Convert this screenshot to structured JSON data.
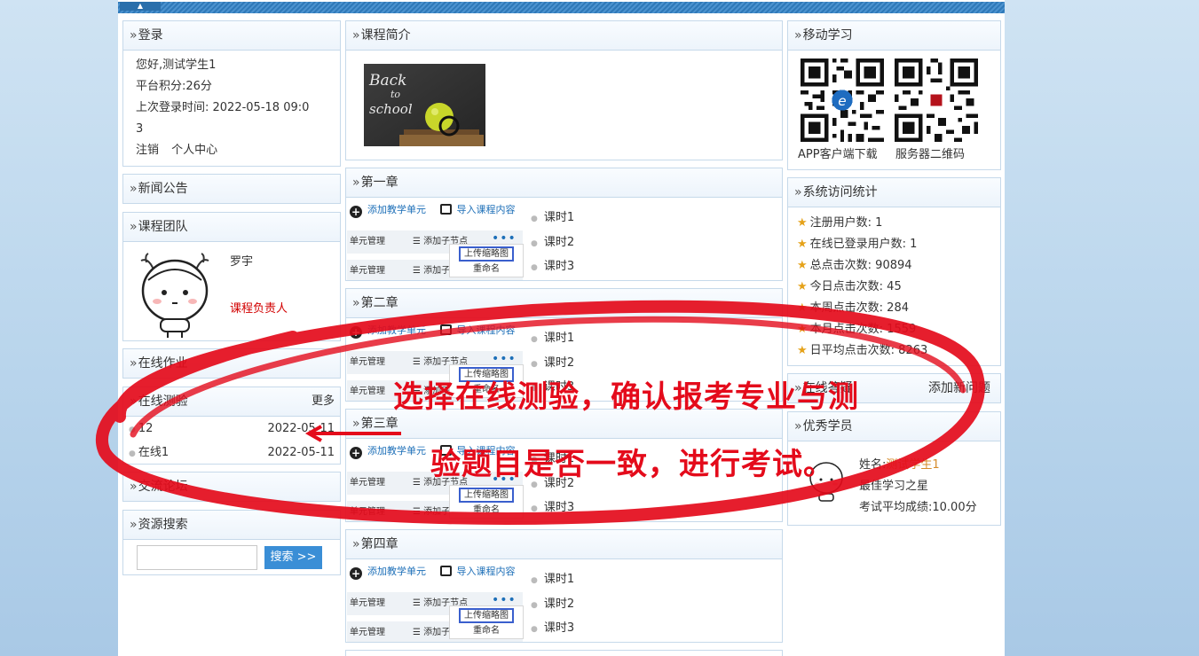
{
  "topbar": {
    "tab_label": "▲"
  },
  "login": {
    "title": "登录",
    "greeting": "您好,测试学生1",
    "points": "平台积分:26分",
    "last_login_line1": "上次登录时间: 2022-05-18 09:0",
    "last_login_line2": "3",
    "logout": "注销",
    "profile": "个人中心"
  },
  "news": {
    "title": "新闻公告"
  },
  "team": {
    "title": "课程团队",
    "member_name": "罗宇",
    "member_role": "课程负责人"
  },
  "homework": {
    "title": "在线作业"
  },
  "quiz": {
    "title": "在线测验",
    "more": "更多",
    "items": [
      {
        "name": "12",
        "date": "2022-05-11"
      },
      {
        "name": "在线1",
        "date": "2022-05-11"
      }
    ]
  },
  "forum": {
    "title": "交流论坛"
  },
  "resource_search": {
    "title": "资源搜索",
    "input_value": "",
    "button": "搜索 >>"
  },
  "intro": {
    "title": "课程简介",
    "image_text": "Back to school"
  },
  "chapter_common": {
    "add_unit": "添加教学单元",
    "import_content": "导入课程内容",
    "unit_manage": "单元管理",
    "add_child": "添加子节点",
    "more_dots": "•••",
    "upload_thumb": "上传缩略图",
    "rename": "重命名"
  },
  "chapters": [
    {
      "title": "第一章",
      "lessons": [
        "课时1",
        "课时2",
        "课时3"
      ]
    },
    {
      "title": "第二章",
      "lessons": [
        "课时1",
        "课时2",
        "课时3"
      ]
    },
    {
      "title": "第三章",
      "lessons": [
        "课时1",
        "课时2",
        "课时3"
      ]
    },
    {
      "title": "第四章",
      "lessons": [
        "课时1",
        "课时2",
        "课时3"
      ]
    }
  ],
  "mobile": {
    "title": "移动学习",
    "app_label": "APP客户端下载",
    "server_label": "服务器二维码"
  },
  "stats": {
    "title": "系统访问统计",
    "items": [
      "注册用户数: 1",
      "在线已登录用户数: 1",
      "总点击次数: 90894",
      "今日点击次数: 45",
      "本周点击次数: 284",
      "本月点击次数: 1559",
      "日平均点击次数: 8263"
    ]
  },
  "online_qa": {
    "title": "在线答疑",
    "add_link": "添加新问题"
  },
  "top_students": {
    "title": "优秀学员",
    "name_label": "姓名:",
    "name": "测试学生1",
    "honor": "最佳学习之星",
    "avg_score": "考试平均成绩:10.00分"
  },
  "annotation": {
    "line1": "选择在线测验，确认报考专业与测",
    "line2": "验题目是否一致，进行考试。",
    "color": "#e40b1b"
  }
}
